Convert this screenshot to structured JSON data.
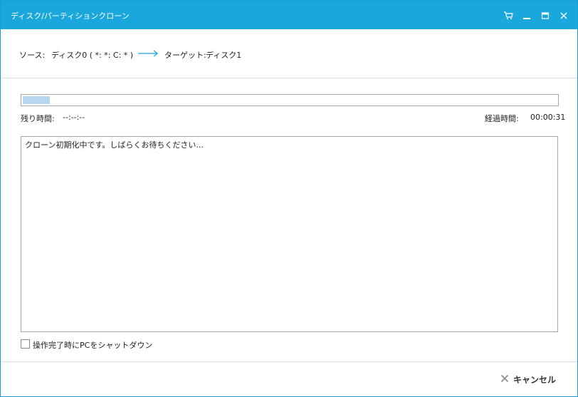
{
  "window": {
    "title": "ディスク/パーティションクローン"
  },
  "titlebar_icons": [
    "cart-icon",
    "minimize-icon",
    "maximize-icon",
    "close-icon"
  ],
  "header": {
    "source_label": "ソース:",
    "source_value": "ディスク0 ( *: *: C: * )",
    "target_label": "ターゲット:",
    "target_value": "ディスク1"
  },
  "progress": {
    "fraction": 0.05
  },
  "times": {
    "remaining_label": "残り時間:",
    "remaining_value": "--:--:--",
    "elapsed_label": "経過時間:",
    "elapsed_value": "00:00:31"
  },
  "log": {
    "lines": [
      "クローン初期化中です。しばらくお待ちください..."
    ]
  },
  "options": {
    "shutdown_label": "操作完了時にPCをシャットダウン",
    "shutdown_checked": false
  },
  "footer": {
    "cancel_label": "キャンセル"
  },
  "colors": {
    "titlebar": "#1aa7dc",
    "arrow": "#1aa7dc",
    "progress_fill": "#b7d7ef"
  }
}
